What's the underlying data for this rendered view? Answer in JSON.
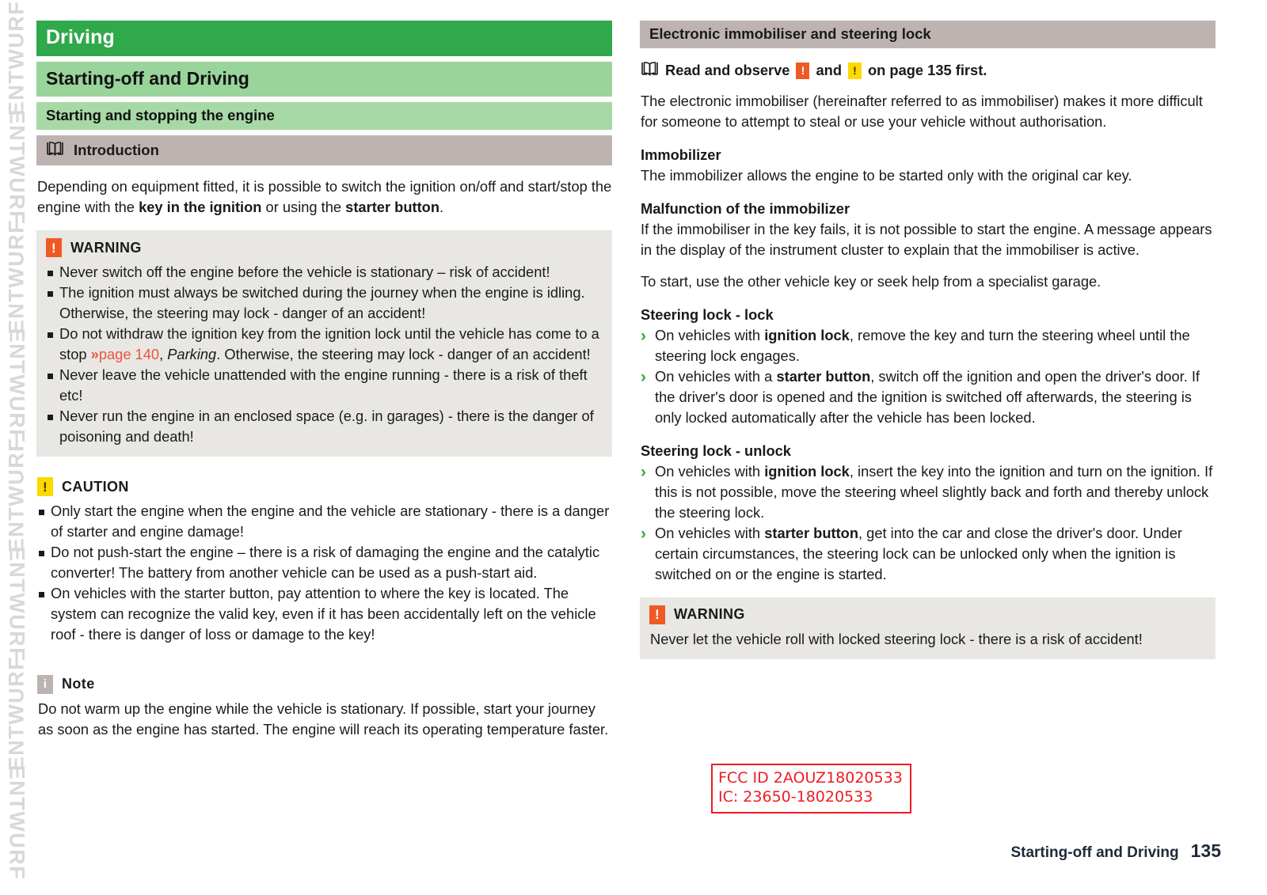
{
  "watermark": {
    "text": "ENTWURF",
    "repeat": 8
  },
  "left_column": {
    "chapter_banner": "Driving",
    "section_banner": "Starting-off and Driving",
    "subsection_banner": "Starting and stopping the engine",
    "intro_banner": {
      "label": "Introduction",
      "icon": "book-icon"
    },
    "intro_paragraph": {
      "part1": "Depending on equipment fitted, it is possible to switch the ignition on/off and start/stop the engine with the ",
      "bold1": "key in the ignition",
      "part2": " or using the ",
      "bold2": "starter button",
      "part3": "."
    },
    "warning": {
      "badge": "!",
      "title": "WARNING",
      "items": [
        "Never switch off the engine before the vehicle is stationary – risk of accident!",
        "The ignition must always be switched during the journey when the engine is idling. Otherwise, the steering may lock - danger of an accident!",
        "Never leave the vehicle unattended with the engine running - there is a risk of theft etc!",
        "Never run the engine in an enclosed space (e.g. in garages) - there is the danger of poisoning and death!"
      ],
      "xref_item": {
        "before": "Do not withdraw the ignition key from the ignition lock until the vehicle has come to a stop ",
        "arrow": "»",
        "link": "page 140",
        "comma": ", ",
        "italic": "Parking",
        "after": ". Otherwise, the steering may lock - danger of an accident!"
      }
    },
    "caution": {
      "badge": "!",
      "title": "CAUTION",
      "items": [
        "Only start the engine when the engine and the vehicle are stationary - there is a danger of starter and engine damage!",
        "Do not push-start the engine – there is a risk of damaging the engine and the catalytic converter! The battery from another vehicle can be used as a push-start aid.",
        "On vehicles with the starter button, pay attention to where the key is located. The system can recognize the valid key, even if it has been accidentally left on the vehicle roof - there is danger of loss or damage to the key!"
      ]
    },
    "note": {
      "badge": "i",
      "title": "Note",
      "text": "Do not warm up the engine while the vehicle is stationary. If possible, start your journey as soon as the engine has started. The engine will reach its operating temperature faster."
    }
  },
  "right_column": {
    "topic_banner": "Electronic immobiliser and steering lock",
    "observe": {
      "icon": "book-icon",
      "text_before": "Read and observe",
      "badge_warn": "!",
      "text_mid": "and",
      "badge_caution": "!",
      "text_after": "on page 135 first."
    },
    "intro_paragraph": "The electronic immobiliser (hereinafter referred to as immobiliser) makes it more difficult for someone to attempt to steal or use your vehicle without authorisation.",
    "immobilizer": {
      "heading": "Immobilizer",
      "text": "The immobilizer allows the engine to be started only with the original car key."
    },
    "malfunction": {
      "heading": "Malfunction of the immobilizer",
      "text": "If the immobiliser in the key fails, it is not possible to start the engine. A message appears in the display of the instrument cluster to explain that the immobiliser is active.",
      "followup": "To start, use the other vehicle key or seek help from a specialist garage."
    },
    "steering_lock_lock": {
      "heading": "Steering lock - lock",
      "items": [
        {
          "before": "On vehicles with ",
          "bold": "ignition lock",
          "after": ", remove the key and turn the steering wheel until the steering lock engages."
        },
        {
          "before": "On vehicles with a ",
          "bold": "starter button",
          "after": ", switch off the ignition and open the driver's door. If the driver's door is opened and the ignition is switched off afterwards, the steering is only locked automatically after the vehicle has been locked."
        }
      ]
    },
    "steering_lock_unlock": {
      "heading": "Steering lock - unlock",
      "items": [
        {
          "before": "On vehicles with ",
          "bold": "ignition lock",
          "after": ", insert the key into the ignition and turn on the ignition. If this is not possible, move the steering wheel slightly back and forth and thereby unlock the steering lock."
        },
        {
          "before": "On vehicles with ",
          "bold": "starter button",
          "after": ", get into the car and close the driver's door. Under certain circumstances, the steering lock can be unlocked only when the ignition is switched on or the engine is started."
        }
      ]
    },
    "warning": {
      "badge": "!",
      "title": "WARNING",
      "text": "Never let the vehicle roll with locked steering lock - there is a risk of accident!"
    }
  },
  "fcc_label": {
    "line1": "FCC ID 2AOUZ18020533",
    "line2": "IC: 23650-18020533"
  },
  "footer": {
    "section": "Starting-off and Driving",
    "page_number": "135"
  },
  "colors": {
    "chapter_green": "#2fa94a",
    "section_green": "#99d49a",
    "grey_banner": "#bdb3b0",
    "notice_bg": "#e8e7e3",
    "warn_orange": "#ef5a24",
    "caution_yellow": "#ffd800",
    "xref_red": "#e8563c",
    "fcc_red": "#ee1c23",
    "arrow_green": "#37a93c"
  }
}
